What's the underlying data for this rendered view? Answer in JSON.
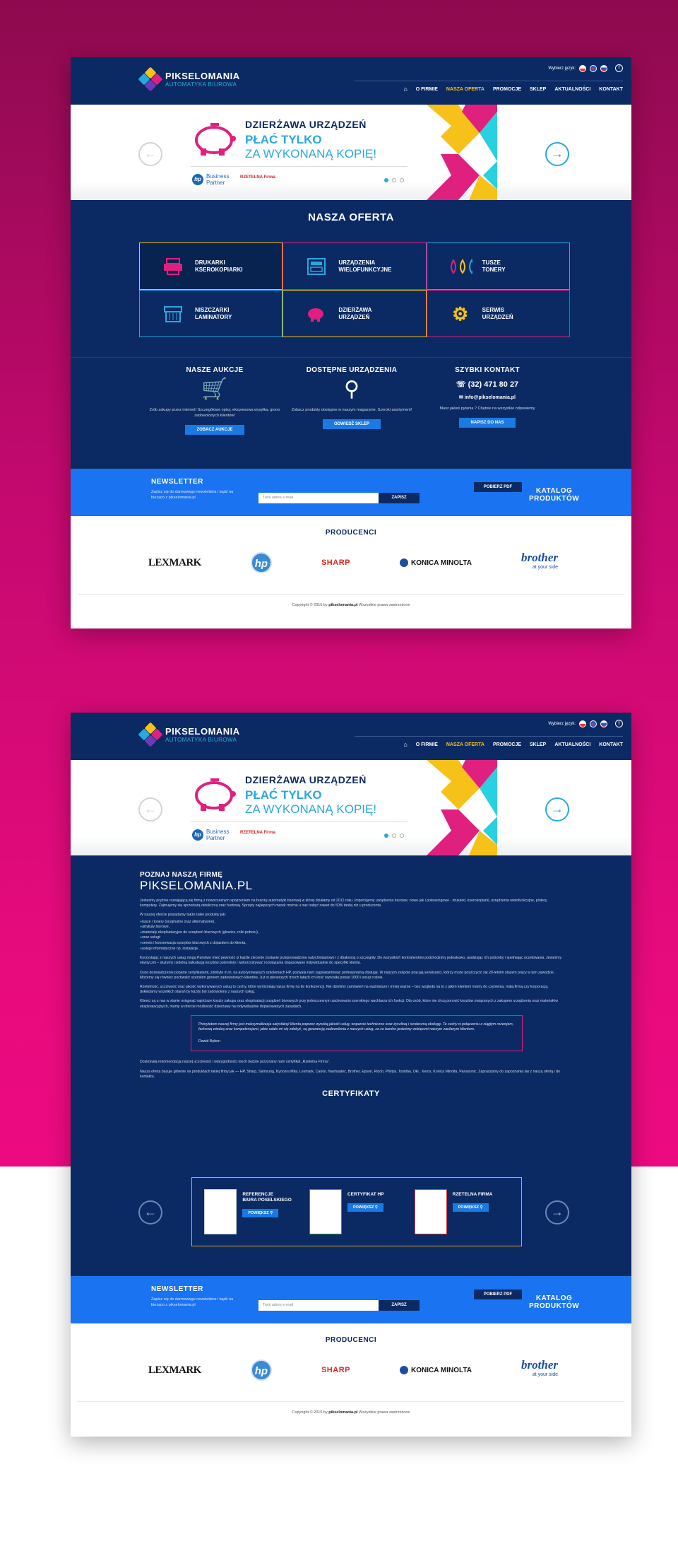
{
  "header": {
    "logo_title": "PIKSELOMANIA",
    "logo_subtitle": "AUTOMATYKA BIUROWA",
    "lang_label": "Wybierz język:",
    "nav": [
      "O FIRMIE",
      "NASZA OFERTA",
      "PROMOCJE",
      "SKLEP",
      "AKTUALNOŚCI",
      "KONTAKT"
    ],
    "fb_icon": "f"
  },
  "banner": {
    "title": "DZIERŻAWA URZĄDZEŃ",
    "sub1": "PŁAĆ TYLKO",
    "sub2": "ZA WYKONANĄ KOPIĘ!",
    "partner_line1": "Business",
    "partner_line2": "Partner",
    "rzetelna": "RZETELNA Firma",
    "hp_short": "hp"
  },
  "offer": {
    "title": "NASZA OFERTA",
    "items": [
      {
        "l1": "DRUKARKI",
        "l2": "KSEROKOPIARKI",
        "icon": "printer-icon",
        "color": "#e0207f"
      },
      {
        "l1": "URZĄDZENIA",
        "l2": "WIELOFUNKCYJNE",
        "icon": "mfp-icon",
        "color": "#29a8e0"
      },
      {
        "l1": "TUSZE",
        "l2": "TONERY",
        "icon": "ink-drops-icon",
        "color": "#f6c21a"
      },
      {
        "l1": "NISZCZARKI",
        "l2": "LAMINATORY",
        "icon": "shredder-icon",
        "color": "#29a8e0"
      },
      {
        "l1": "DZIERŻAWA",
        "l2": "URZĄDZEŃ",
        "icon": "piggy-bank-icon",
        "color": "#e0207f"
      },
      {
        "l1": "SERWIS",
        "l2": "URZĄDZEŃ",
        "icon": "gear-icon",
        "color": "#f6c21a"
      }
    ]
  },
  "columns": {
    "auctions_title": "NASZE AUKCJE",
    "auctions_text": "Zrób zakupy przez internet! Szczegółowe opisy, ekspresowa wysyłka, grono zadowolonych klientów!",
    "auctions_btn": "ZOBACZ AUKCJE",
    "devices_title": "DOSTĘPNE URZĄDZENIA",
    "devices_text": "Zobacz produkty dostępne w naszym magazynie. Szeroki asortyment!",
    "devices_btn": "ODWIEDŹ SKLEP",
    "contact_title": "SZYBKI KONTAKT",
    "phone": "(32) 471 80 27",
    "email": "info@pikselomania.pl",
    "contact_text": "Masz jakieś pytania ? Chętnie na wszystkie odpowiemy",
    "contact_btn": "NAPISZ DO NAS"
  },
  "newsletter": {
    "title": "NEWSLETTER",
    "text1": "Zapisz się do darmowego newslettera i bądź na",
    "text2": "bieżąco z pikselomania.pl",
    "placeholder": "Twój adres e-mail",
    "button": "ZAPISZ",
    "catalog_title": "KATALOG PRODUKTÓW",
    "catalog_btn": "POBIERZ PDF"
  },
  "producers": {
    "title": "PRODUCENCI",
    "brands": [
      "LEXMARK",
      "hp",
      "SHARP",
      "KONICA MINOLTA",
      "brother"
    ],
    "brother_tag": "at your side"
  },
  "footer": {
    "pre": "Copyright © 2015 by ",
    "site": "pikselomania.pl",
    "post": " Wszystkie prawa zastrzeżone"
  },
  "about": {
    "title": "POZNAJ NASZĄ FIRMĘ",
    "name": "PIKSELOMANIA.PL",
    "p1": "Jesteśmy prężnie rozwijającą się firmą z nowoczesnym spojrzeniem na branżę automatyki biurowej w której działamy od 2012 roku. Importujemy urządzenia biurowe, nowe jak i poleasingowe - drukarki, kserokopiarki, urządzenia wielofunkcyjne, plotery, komputery. Zajmujemy się sprzedażą detaliczną oraz hurtową. Sprzęty najlepszych marek można u nas nabyć nawet do 50% taniej niż u producenta.",
    "list_intro": "W naszej ofercie posiadamy także takie produkty jak:",
    "list": [
      "tusze i tonery (oryginalne oraz alternatywne),",
      "artykuły biurowe,",
      "materiały eksploatacyjne do urządzeń biurowych (głowice, rolki poboru),",
      "oraz usługi:",
      "serwis i konserwacja sprzętów biurowych z dojazdem do klienta,",
      "usługi informatyczne np. instalacje."
    ],
    "p2": "Korzystając z naszych usług mogą Państwo mieć pewność iż każde zlecenie zostanie przeprowadzone natychmiastowo i z dbałością o szczegóły. Do wszystkich kontrahentów podchodzimy jednakowo, analizując ich potrzeby i spełniając oczekiwania. Jesteśmy elastyczni – służymy rzetelną kalkulacją kosztów pośrednio i wykorzystywać rozwiązania dopasowane indywidualnie do specyfiki klienta.",
    "p3": "Duże doświadczenie poparte certyfikatami, zdobyte m.in. na autoryzowanych szkoleniach HP, pozwala nam zagwarantować profesjonalną obsługę. W naszym zespole pracują serwisanci, którzy może poszczycić się 20-letnim stażem pracy w tym zawodzie. Możemy się również pochwalić szerokim gronem zadowolonych klientów. Już w pierwszych trzech latach ich ilość wynosiła ponad 1000 i wciąż rośnie.",
    "p4": "Rzetelność, uczciwość oraz jakość wykonywanych usług to cechy, które wyróżniają naszą firmę na tle konkurencji. Nie dzielimy zamówień na ważniejsze i mniej ważne – bez względu na to z jakim klientem mamy do czynienia, małą firmą czy korporacją, dokładamy wszelkich starań by każdy był zadowolony z naszych usług.",
    "p5": "Klienci są u nas w stanie osiągnąć najniższe koszty zakupu oraz eksploatacji urządzeń biurowych przy jednoczesnym zachowaniu szerokiego wachlarza ich funkcji. Dla osób, które nie chcą ponosić kosztów związanych z zakupem urządzenia oraz materiałów eksploatacyjnych, mamy w ofercie możliwość dzierżawy na indywidualnie dopasowanych zasadach.",
    "quote": "Priorytetem naszej firmy jest maksymalizacja satysfakcji klienta poprzez wysoką jakość usług, wsparcie techniczne oraz życzliwą i serdeczną obsługę. Te cechy w połączeniu z ciągłym rozwojem, fachową wiedzą oraz kompetencjami, jakie udało mi się zdobyć, są gwarancją zadowolenia z naszych usług, za co bardzo jesteśmy wdzięczni naszym zaufanym klientom.",
    "quote_author": "Dawid Bęben",
    "p6": "Doskonałą rekomendacją naszej uczciwości i wiarygodności niech będzie przyznany nam certyfikat „Rzetelna Firma\".",
    "p7": "Nasza oferta bazuje głównie na produktach takiej firmy jak — HP, Sharp, Samsung, Kyocera Mita, Lexmark, Canon, Nashuatec, Brother, Epson, Ricoh, Philips, Toshiba, Oki , Xerox, Konica Minolta, Panasonic. Zapraszamy do zapoznania się z naszą ofertą i do kontaktu."
  },
  "certs": {
    "title": "CERTYFIKATY",
    "items": [
      {
        "l1": "REFERENCJE",
        "l2": "BIURA POSELSKIEGO",
        "btn": "POWIĘKSZ"
      },
      {
        "l1": "CERTYFIKAT HP",
        "l2": "",
        "btn": "POWIĘKSZ"
      },
      {
        "l1": "RZETELNA FIRMA",
        "l2": "",
        "btn": "POWIĘKSZ"
      }
    ]
  }
}
